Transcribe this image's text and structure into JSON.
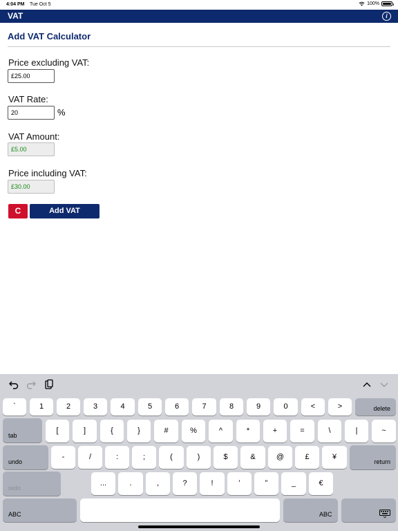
{
  "status_bar": {
    "time": "4:04 PM",
    "date": "Tue Oct 5",
    "battery": "100%"
  },
  "nav": {
    "title": "VAT",
    "info_label": "i"
  },
  "page": {
    "title": "Add VAT Calculator",
    "price_ex_label": "Price excluding VAT:",
    "price_ex_value": "£25.00",
    "vat_rate_label": "VAT Rate:",
    "vat_rate_value": "20",
    "percent": "%",
    "vat_amount_label": "VAT Amount:",
    "vat_amount_value": "£5.00",
    "price_inc_label": "Price including VAT:",
    "price_inc_value": "£30.00",
    "clear_label": "C",
    "add_vat_label": "Add VAT"
  },
  "keyboard": {
    "row1": [
      "`",
      "1",
      "2",
      "3",
      "4",
      "5",
      "6",
      "7",
      "8",
      "9",
      "0",
      "<",
      ">"
    ],
    "delete": "delete",
    "tab": "tab",
    "row2": [
      "[",
      "]",
      "{",
      "}",
      "#",
      "%",
      "^",
      "*",
      "+",
      "=",
      "\\",
      "|",
      "~"
    ],
    "undo": "undo",
    "row3": [
      "-",
      "/",
      ":",
      ";",
      "(",
      ")",
      "$",
      "&",
      "@",
      "£",
      "¥"
    ],
    "return": "return",
    "redo": "redo",
    "row4": [
      "...",
      ".",
      ",",
      "?",
      "!",
      "’",
      "”",
      "_",
      "€"
    ],
    "abc_left": "ABC",
    "abc_right": "ABC"
  },
  "colors": {
    "nav": "#0e2a6e",
    "clear": "#cf102d",
    "result_text": "#1a8a1a"
  }
}
